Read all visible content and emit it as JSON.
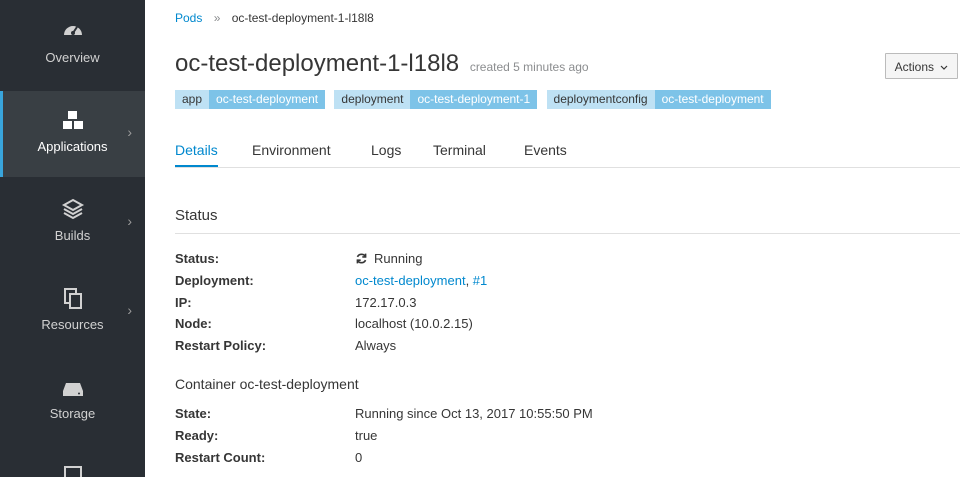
{
  "sidebar": {
    "items": [
      {
        "label": "Overview",
        "icon": "dashboard-icon"
      },
      {
        "label": "Applications",
        "icon": "cubes-icon",
        "active": true
      },
      {
        "label": "Builds",
        "icon": "layers-icon"
      },
      {
        "label": "Resources",
        "icon": "files-icon"
      },
      {
        "label": "Storage",
        "icon": "hard-drive-icon"
      },
      {
        "label": "",
        "icon": "monitor-icon"
      }
    ]
  },
  "breadcrumb": {
    "parent": "Pods",
    "separator": "»",
    "current": "oc-test-deployment-1-l18l8"
  },
  "header": {
    "title": "oc-test-deployment-1-l18l8",
    "created": "created 5 minutes ago",
    "actions_label": "Actions"
  },
  "labels": [
    {
      "key": "app",
      "value": "oc-test-deployment"
    },
    {
      "key": "deployment",
      "value": "oc-test-deployment-1"
    },
    {
      "key": "deploymentconfig",
      "value": "oc-test-deployment"
    }
  ],
  "tabs": [
    "Details",
    "Environment",
    "Logs",
    "Terminal",
    "Events"
  ],
  "status_section": {
    "title": "Status",
    "rows": {
      "status": {
        "key": "Status:",
        "value": "Running"
      },
      "deployment": {
        "key": "Deployment:",
        "link": "oc-test-deployment",
        "sep": ", ",
        "number": "#1"
      },
      "ip": {
        "key": "IP:",
        "value": "172.17.0.3"
      },
      "node": {
        "key": "Node:",
        "value": "localhost (10.0.2.15)"
      },
      "restart_policy": {
        "key": "Restart Policy:",
        "value": "Always"
      }
    }
  },
  "container_section": {
    "title": "Container oc-test-deployment",
    "rows": {
      "state": {
        "key": "State:",
        "value": "Running since Oct 13, 2017 10:55:50 PM"
      },
      "ready": {
        "key": "Ready:",
        "value": "true"
      },
      "restart_count": {
        "key": "Restart Count:",
        "value": "0"
      }
    }
  },
  "colors": {
    "sidebar_bg": "#292e34",
    "accent": "#0088ce",
    "label_key_bg": "#bee1f4",
    "label_value_bg": "#7dc3e8"
  }
}
